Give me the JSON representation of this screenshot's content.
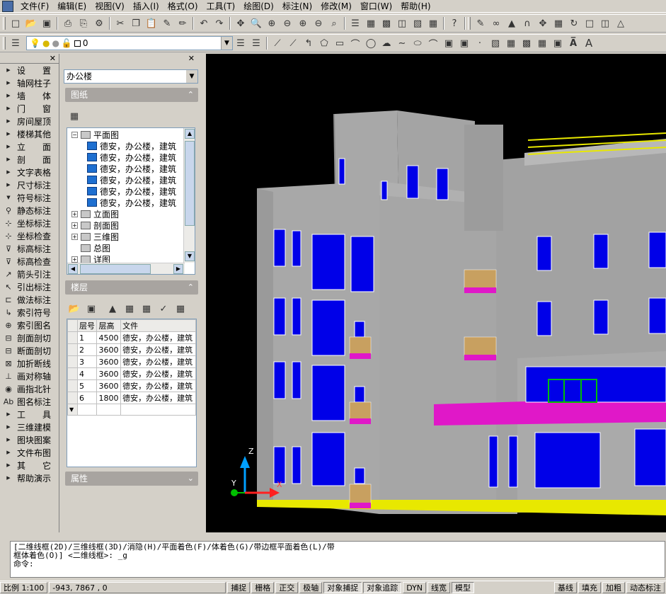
{
  "menubar": {
    "items": [
      "文件(F)",
      "编辑(E)",
      "视图(V)",
      "插入(I)",
      "格式(O)",
      "工具(T)",
      "绘图(D)",
      "标注(N)",
      "修改(M)",
      "窗口(W)",
      "帮助(H)"
    ]
  },
  "layer_toolbar": {
    "current_layer": "0"
  },
  "left_menu": {
    "items": [
      {
        "label": "设　　置",
        "icon": "arrow"
      },
      {
        "label": "轴网柱子",
        "icon": "arrow"
      },
      {
        "label": "墙　　体",
        "icon": "arrow"
      },
      {
        "label": "门　　窗",
        "icon": "arrow"
      },
      {
        "label": "房间屋顶",
        "icon": "arrow"
      },
      {
        "label": "楼梯其他",
        "icon": "arrow"
      },
      {
        "label": "立　　面",
        "icon": "arrow"
      },
      {
        "label": "剖　　面",
        "icon": "arrow"
      },
      {
        "label": "文字表格",
        "icon": "arrow"
      },
      {
        "label": "尺寸标注",
        "icon": "arrow"
      },
      {
        "label": "符号标注",
        "icon": "arrow-down"
      },
      {
        "label": "静态标注",
        "icon": "pin"
      },
      {
        "label": "坐标标注",
        "icon": "coord"
      },
      {
        "label": "坐标检查",
        "icon": "coord-check"
      },
      {
        "label": "标高标注",
        "icon": "elev"
      },
      {
        "label": "标高检查",
        "icon": "elev-check"
      },
      {
        "label": "箭头引注",
        "icon": "arrow-lead"
      },
      {
        "label": "引出标注",
        "icon": "lead"
      },
      {
        "label": "做法标注",
        "icon": "method"
      },
      {
        "label": "索引符号",
        "icon": "index"
      },
      {
        "label": "索引图名",
        "icon": "index-name"
      },
      {
        "label": "剖面剖切",
        "icon": "section"
      },
      {
        "label": "断面剖切",
        "icon": "break-section"
      },
      {
        "label": "加折断线",
        "icon": "break-line"
      },
      {
        "label": "画对称轴",
        "icon": "sym-axis"
      },
      {
        "label": "画指北针",
        "icon": "north"
      },
      {
        "label": "图名标注",
        "icon": "title"
      },
      {
        "label": "工　　具",
        "icon": "arrow"
      },
      {
        "label": "三维建模",
        "icon": "arrow"
      },
      {
        "label": "图块图案",
        "icon": "arrow"
      },
      {
        "label": "文件布图",
        "icon": "arrow"
      },
      {
        "label": "其　　它",
        "icon": "arrow"
      },
      {
        "label": "帮助演示",
        "icon": "arrow"
      }
    ]
  },
  "project_panel": {
    "project_name": "办公楼",
    "drawings_header": "图纸",
    "tree": [
      {
        "label": "平面图",
        "level": 0,
        "toggle": "⊟"
      },
      {
        "label": "德安，办公楼，建筑",
        "level": 1
      },
      {
        "label": "德安，办公楼，建筑",
        "level": 1
      },
      {
        "label": "德安，办公楼，建筑",
        "level": 1
      },
      {
        "label": "德安，办公楼，建筑",
        "level": 1
      },
      {
        "label": "德安，办公楼，建筑",
        "level": 1
      },
      {
        "label": "德安，办公楼，建筑",
        "level": 1
      },
      {
        "label": "立面图",
        "level": 0,
        "toggle": "⊞"
      },
      {
        "label": "剖面图",
        "level": 0,
        "toggle": "⊞"
      },
      {
        "label": "三维图",
        "level": 0,
        "toggle": "⊞"
      },
      {
        "label": "总图",
        "level": 0,
        "toggle": ""
      },
      {
        "label": "详图",
        "level": 0,
        "toggle": "⊞"
      }
    ],
    "floors_header": "楼层",
    "floor_table": {
      "columns": [
        "层号",
        "层高",
        "文件"
      ],
      "rows": [
        [
          "1",
          "4500",
          "德安，办公楼，建筑"
        ],
        [
          "2",
          "3600",
          "德安，办公楼，建筑"
        ],
        [
          "3",
          "3600",
          "德安，办公楼，建筑"
        ],
        [
          "4",
          "3600",
          "德安，办公楼，建筑"
        ],
        [
          "5",
          "3600",
          "德安，办公楼，建筑"
        ],
        [
          "6",
          "1800",
          "德安，办公楼，建筑"
        ]
      ]
    },
    "properties_header": "属性"
  },
  "command": {
    "line1": "[二维线框(2D)/三维线框(3D)/消隐(H)/平面着色(F)/体着色(G)/带边框平面着色(L)/带",
    "line2": "框体着色(O)] <二维线框>: _g",
    "prompt": "命令:"
  },
  "status": {
    "scale": "比例 1:100",
    "coords": "-943,    7867   , 0",
    "toggles": [
      {
        "label": "捕捉",
        "on": false
      },
      {
        "label": "栅格",
        "on": false
      },
      {
        "label": "正交",
        "on": false
      },
      {
        "label": "极轴",
        "on": false
      },
      {
        "label": "对象捕捉",
        "on": true
      },
      {
        "label": "对象追踪",
        "on": true
      },
      {
        "label": "DYN",
        "on": false
      },
      {
        "label": "线宽",
        "on": false
      },
      {
        "label": "模型",
        "on": true
      }
    ],
    "right_toggles": [
      "基线",
      "填充",
      "加粗",
      "动态标注"
    ]
  },
  "viewport": {
    "background": "#000000",
    "axis_labels": [
      "Z",
      "Y",
      "X"
    ]
  }
}
